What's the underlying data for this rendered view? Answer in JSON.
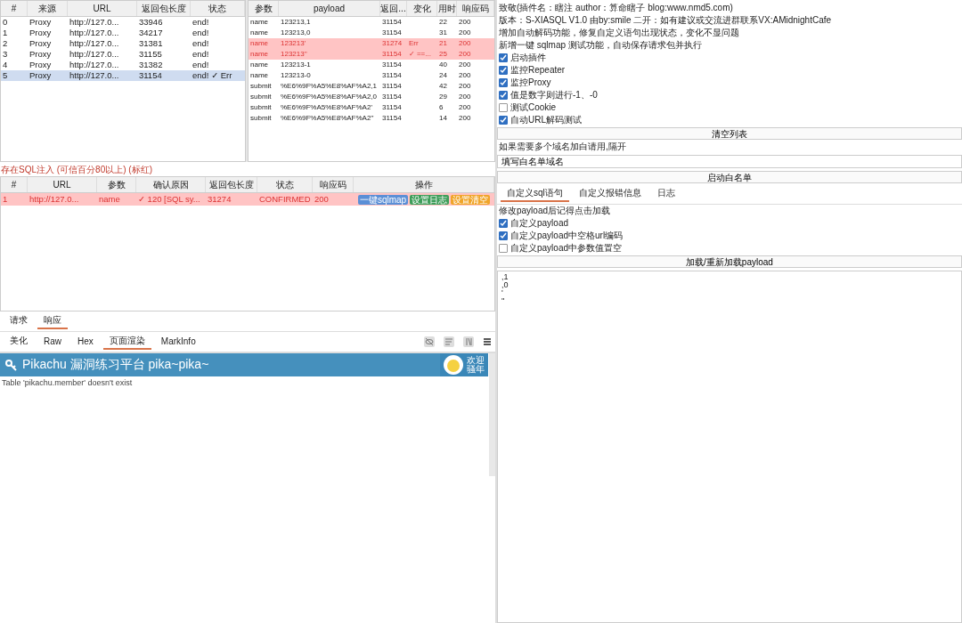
{
  "requests_table": {
    "columns": [
      "#",
      "来源",
      "URL",
      "返回包长度",
      "状态"
    ],
    "rows": [
      {
        "cells": [
          "0",
          "Proxy",
          "http://127.0...",
          "33946",
          "end!"
        ],
        "selected": false
      },
      {
        "cells": [
          "1",
          "Proxy",
          "http://127.0...",
          "34217",
          "end!"
        ],
        "selected": false
      },
      {
        "cells": [
          "2",
          "Proxy",
          "http://127.0...",
          "31381",
          "end!"
        ],
        "selected": false
      },
      {
        "cells": [
          "3",
          "Proxy",
          "http://127.0...",
          "31155",
          "end!"
        ],
        "selected": false
      },
      {
        "cells": [
          "4",
          "Proxy",
          "http://127.0...",
          "31382",
          "end!"
        ],
        "selected": false
      },
      {
        "cells": [
          "5",
          "Proxy",
          "http://127.0...",
          "31154",
          "end! ✓ Err"
        ],
        "selected": true
      }
    ]
  },
  "payload_table": {
    "columns": [
      "参数",
      "payload",
      "返回...",
      "变化",
      "用时",
      "响应码"
    ],
    "rows": [
      {
        "cells": [
          "name",
          "123213,1",
          "31154",
          "",
          "22",
          "200"
        ],
        "highlighted": false
      },
      {
        "cells": [
          "name",
          "123213,0",
          "31154",
          "",
          "31",
          "200"
        ],
        "highlighted": false
      },
      {
        "cells": [
          "name",
          "123213'",
          "31274",
          "Err",
          "21",
          "200"
        ],
        "highlighted": true
      },
      {
        "cells": [
          "name",
          "123213''",
          "31154",
          "✓ ==...",
          "25",
          "200"
        ],
        "highlighted": true
      },
      {
        "cells": [
          "name",
          "123213-1",
          "31154",
          "",
          "40",
          "200"
        ],
        "highlighted": false
      },
      {
        "cells": [
          "name",
          "123213-0",
          "31154",
          "",
          "24",
          "200"
        ],
        "highlighted": false
      },
      {
        "cells": [
          "submit",
          "%E6%9F%A5%E8%AF%A2,1",
          "31154",
          "",
          "42",
          "200"
        ],
        "highlighted": false
      },
      {
        "cells": [
          "submit",
          "%E6%9F%A5%E8%AF%A2,0",
          "31154",
          "",
          "29",
          "200"
        ],
        "highlighted": false
      },
      {
        "cells": [
          "submit",
          "%E6%9F%A5%E8%AF%A2'",
          "31154",
          "",
          "6",
          "200"
        ],
        "highlighted": false
      },
      {
        "cells": [
          "submit",
          "%E6%9F%A5%E8%AF%A2''",
          "31154",
          "",
          "14",
          "200"
        ],
        "highlighted": false
      }
    ]
  },
  "findings_label": "存在SQL注入 (可信百分80以上) (标红)",
  "findings_table": {
    "columns": [
      "#",
      "URL",
      "参数",
      "确认原因",
      "返回包长度",
      "状态",
      "响应码",
      "操作"
    ],
    "rows": [
      {
        "cells": [
          "1",
          "http://127.0...",
          "name",
          "✓ 120 [SQL sy...",
          "31274",
          "CONFIRMED",
          "200"
        ],
        "highlighted": true,
        "actions": [
          {
            "label": "一键sqlmap",
            "color": "#5b8fd6"
          },
          {
            "label": "设置日志",
            "color": "#3f9e5a"
          },
          {
            "label": "设置清空",
            "color": "#f0a52a"
          }
        ]
      }
    ]
  },
  "message_tabs": [
    {
      "label": "请求",
      "selected": false
    },
    {
      "label": "响应",
      "selected": true
    }
  ],
  "view_tabs": [
    {
      "label": "美化",
      "selected": false
    },
    {
      "label": "Raw",
      "selected": false
    },
    {
      "label": "Hex",
      "selected": false
    },
    {
      "label": "页面渲染",
      "selected": true
    },
    {
      "label": "MarkInfo",
      "selected": false
    }
  ],
  "rendered_page": {
    "title": "Pikachu 漏洞练习平台 pika~pika~",
    "greeting": [
      "欢迎",
      "骚年"
    ],
    "body": "Table 'pikachu.member' doesn't exist"
  },
  "info_lines": [
    "致敬(插件名：瞎注 author：算命瞎子 blog:www.nmd5.com)",
    "版本：S-XIASQL V1.0 由by:smile 二开：如有建议或交流进群联系VX:AMidnightCafe",
    "增加自动解码功能，修复自定义语句出现状态，变化不显问题",
    "新增一键 sqlmap 测试功能，自动保存请求包并执行"
  ],
  "options": [
    {
      "label": "启动插件",
      "checked": true
    },
    {
      "label": "监控Repeater",
      "checked": true
    },
    {
      "label": "监控Proxy",
      "checked": true
    },
    {
      "label": "值是数字则进行-1、-0",
      "checked": true
    },
    {
      "label": "测试Cookie",
      "checked": false
    },
    {
      "label": "自动URL解码测试",
      "checked": true
    }
  ],
  "clear_button": "清空列表",
  "whitelist_hint": "如果需要多个域名加白请用,隔开",
  "whitelist_field": {
    "value": "填写白名单域名"
  },
  "whitelist_button": "启动白名单",
  "config_tabs": [
    {
      "label": "自定义sql语句",
      "selected": true
    },
    {
      "label": "自定义报错信息",
      "selected": false
    },
    {
      "label": "日志",
      "selected": false
    }
  ],
  "config_note": "修改payload后记得点击加载",
  "config_options": [
    {
      "label": "自定义payload",
      "checked": true
    },
    {
      "label": "自定义payload中空格url编码",
      "checked": true
    },
    {
      "label": "自定义payload中参数值置空",
      "checked": false
    }
  ],
  "load_button": "加载/重新加载payload",
  "payload_lines": [
    ",1",
    ",0",
    "'",
    "''"
  ]
}
